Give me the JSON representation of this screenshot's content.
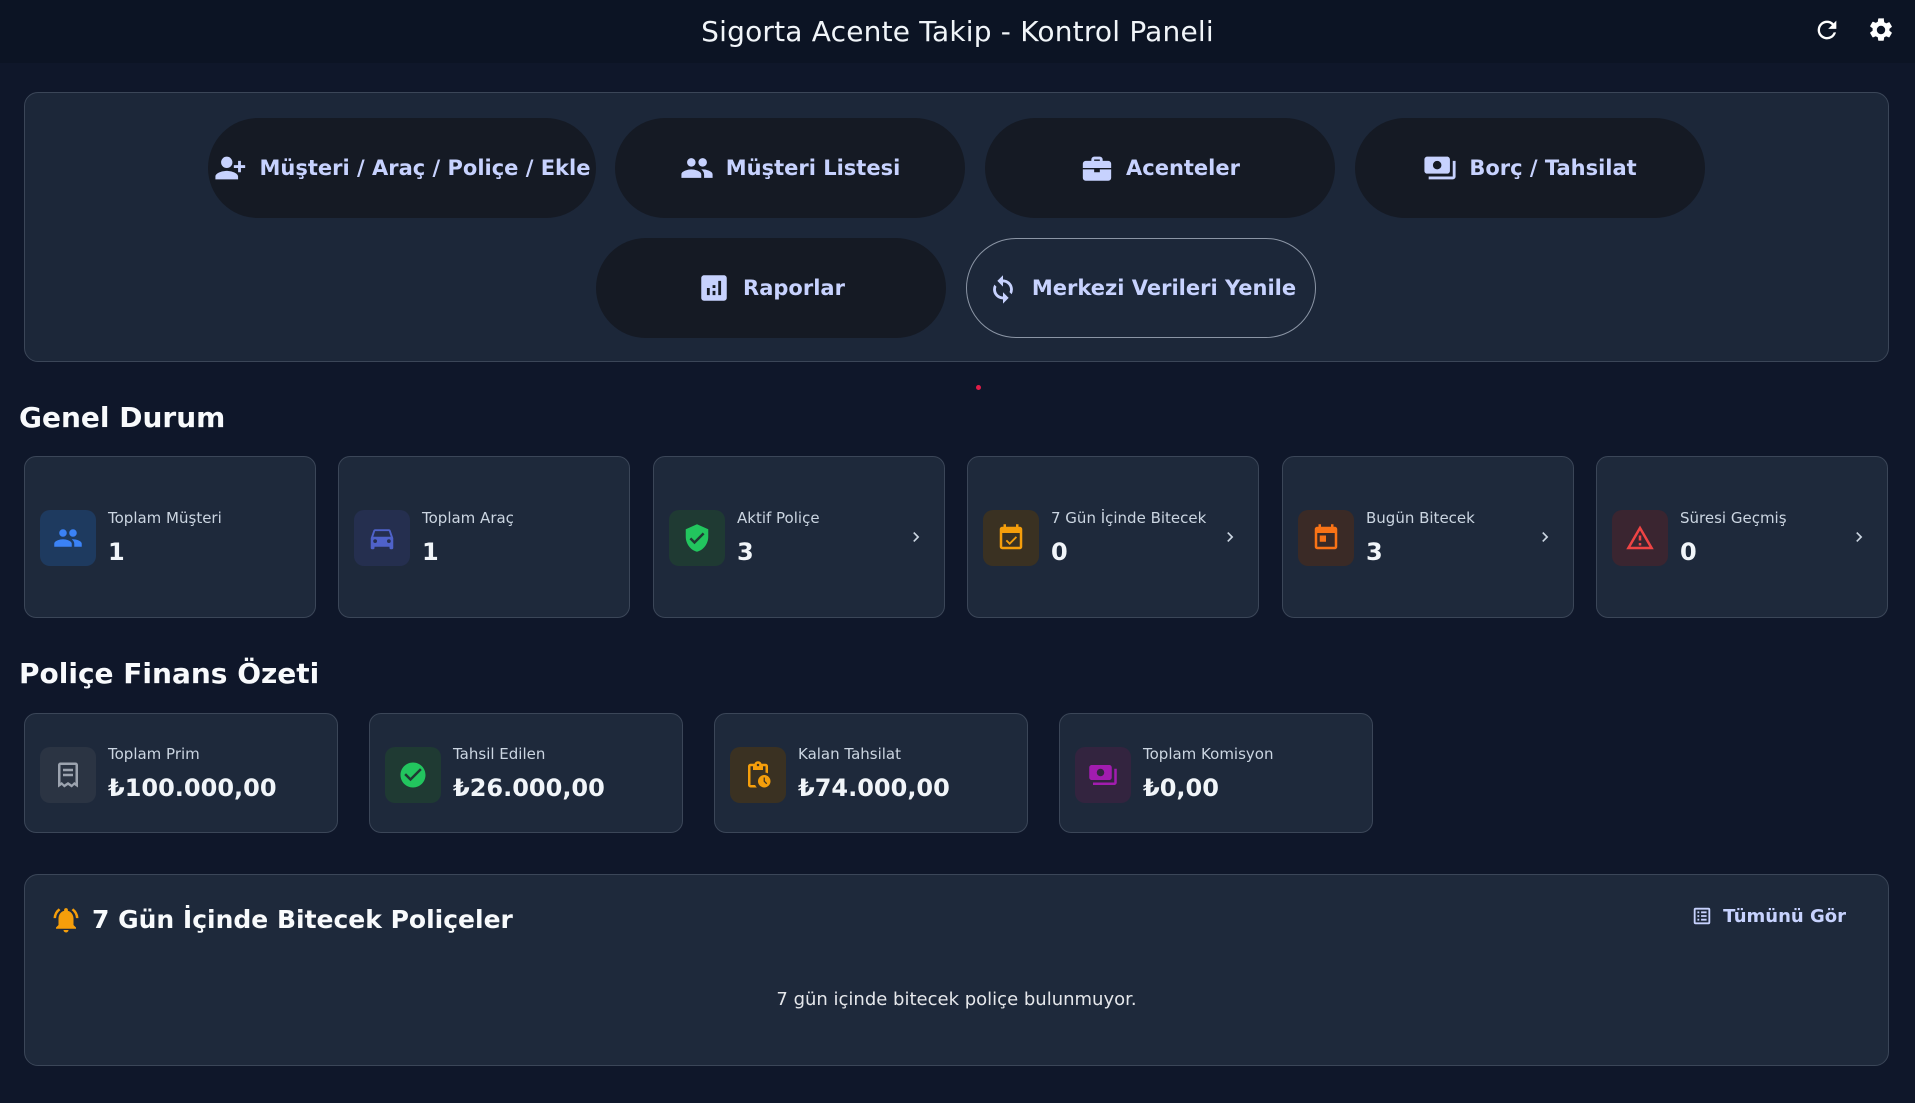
{
  "app": {
    "title": "Sigorta Acente Takip - Kontrol Paneli"
  },
  "topbar": {
    "refresh_icon": "refresh-icon",
    "settings_icon": "gear-icon"
  },
  "nav": {
    "buttons": [
      {
        "label": "Müşteri / Araç / Poliçe / Ekle",
        "icon": "user-plus-icon"
      },
      {
        "label": "Müşteri Listesi",
        "icon": "users-icon"
      },
      {
        "label": "Acenteler",
        "icon": "briefcase-icon"
      },
      {
        "label": "Borç / Tahsilat",
        "icon": "money-icon"
      },
      {
        "label": "Raporlar",
        "icon": "report-icon"
      },
      {
        "label": "Merkezi Verileri Yenile",
        "icon": "sync-icon"
      }
    ]
  },
  "general": {
    "title": "Genel Durum",
    "cards": [
      {
        "label": "Toplam Müşteri",
        "value": "1",
        "icon": "users-icon",
        "color": "#3b82f6"
      },
      {
        "label": "Toplam Araç",
        "value": "1",
        "icon": "car-icon",
        "color": "#4f62c9"
      },
      {
        "label": "Aktif Poliçe",
        "value": "3",
        "icon": "shield-check-icon",
        "color": "#22c55e"
      },
      {
        "label": "7 Gün İçinde Bitecek",
        "value": "0",
        "icon": "calendar-check-icon",
        "color": "#f59e0b"
      },
      {
        "label": "Bugün Bitecek",
        "value": "3",
        "icon": "calendar-today-icon",
        "color": "#f97316"
      },
      {
        "label": "Süresi Geçmiş",
        "value": "0",
        "icon": "warning-icon",
        "color": "#ef4444"
      }
    ]
  },
  "finance": {
    "title": "Poliçe Finans Özeti",
    "cards": [
      {
        "label": "Toplam Prim",
        "value": "₺100.000,00",
        "icon": "receipt-icon",
        "color": "#9ca3af"
      },
      {
        "label": "Tahsil Edilen",
        "value": "₺26.000,00",
        "icon": "check-circle-icon",
        "color": "#22c55e"
      },
      {
        "label": "Kalan Tahsilat",
        "value": "₺74.000,00",
        "icon": "clipboard-clock-icon",
        "color": "#f59e0b"
      },
      {
        "label": "Toplam Komisyon",
        "value": "₺0,00",
        "icon": "money-icon",
        "color": "#a21caf"
      }
    ]
  },
  "expiring": {
    "title": "7 Gün İçinde Bitecek Poliçeler",
    "see_all": "Tümünü Gör",
    "empty_text": "7 gün içinde bitecek poliçe bulunmuyor."
  }
}
